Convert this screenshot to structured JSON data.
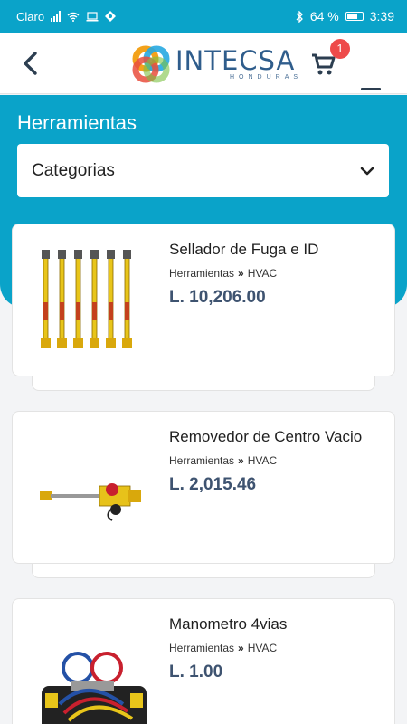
{
  "status_bar": {
    "carrier": "Claro",
    "battery": "64 %",
    "time": "3:39"
  },
  "header": {
    "logo_name": "INTECSA",
    "logo_sub": "HONDURAS",
    "cart_count": "1"
  },
  "page": {
    "title": "Herramientas",
    "category_select": "Categorias"
  },
  "products": [
    {
      "name": "Sellador de Fuga e ID",
      "category": "Herramientas",
      "subcategory": "HVAC",
      "price": "L. 10,206.00"
    },
    {
      "name": "Removedor de Centro Vacio",
      "category": "Herramientas",
      "subcategory": "HVAC",
      "price": "L. 2,015.46"
    },
    {
      "name": "Manometro 4vias",
      "category": "Herramientas",
      "subcategory": "HVAC",
      "price": "L. 1.00"
    }
  ],
  "colors": {
    "primary": "#0aa3c9",
    "price": "#3e5370",
    "badge": "#ee4b4b"
  }
}
